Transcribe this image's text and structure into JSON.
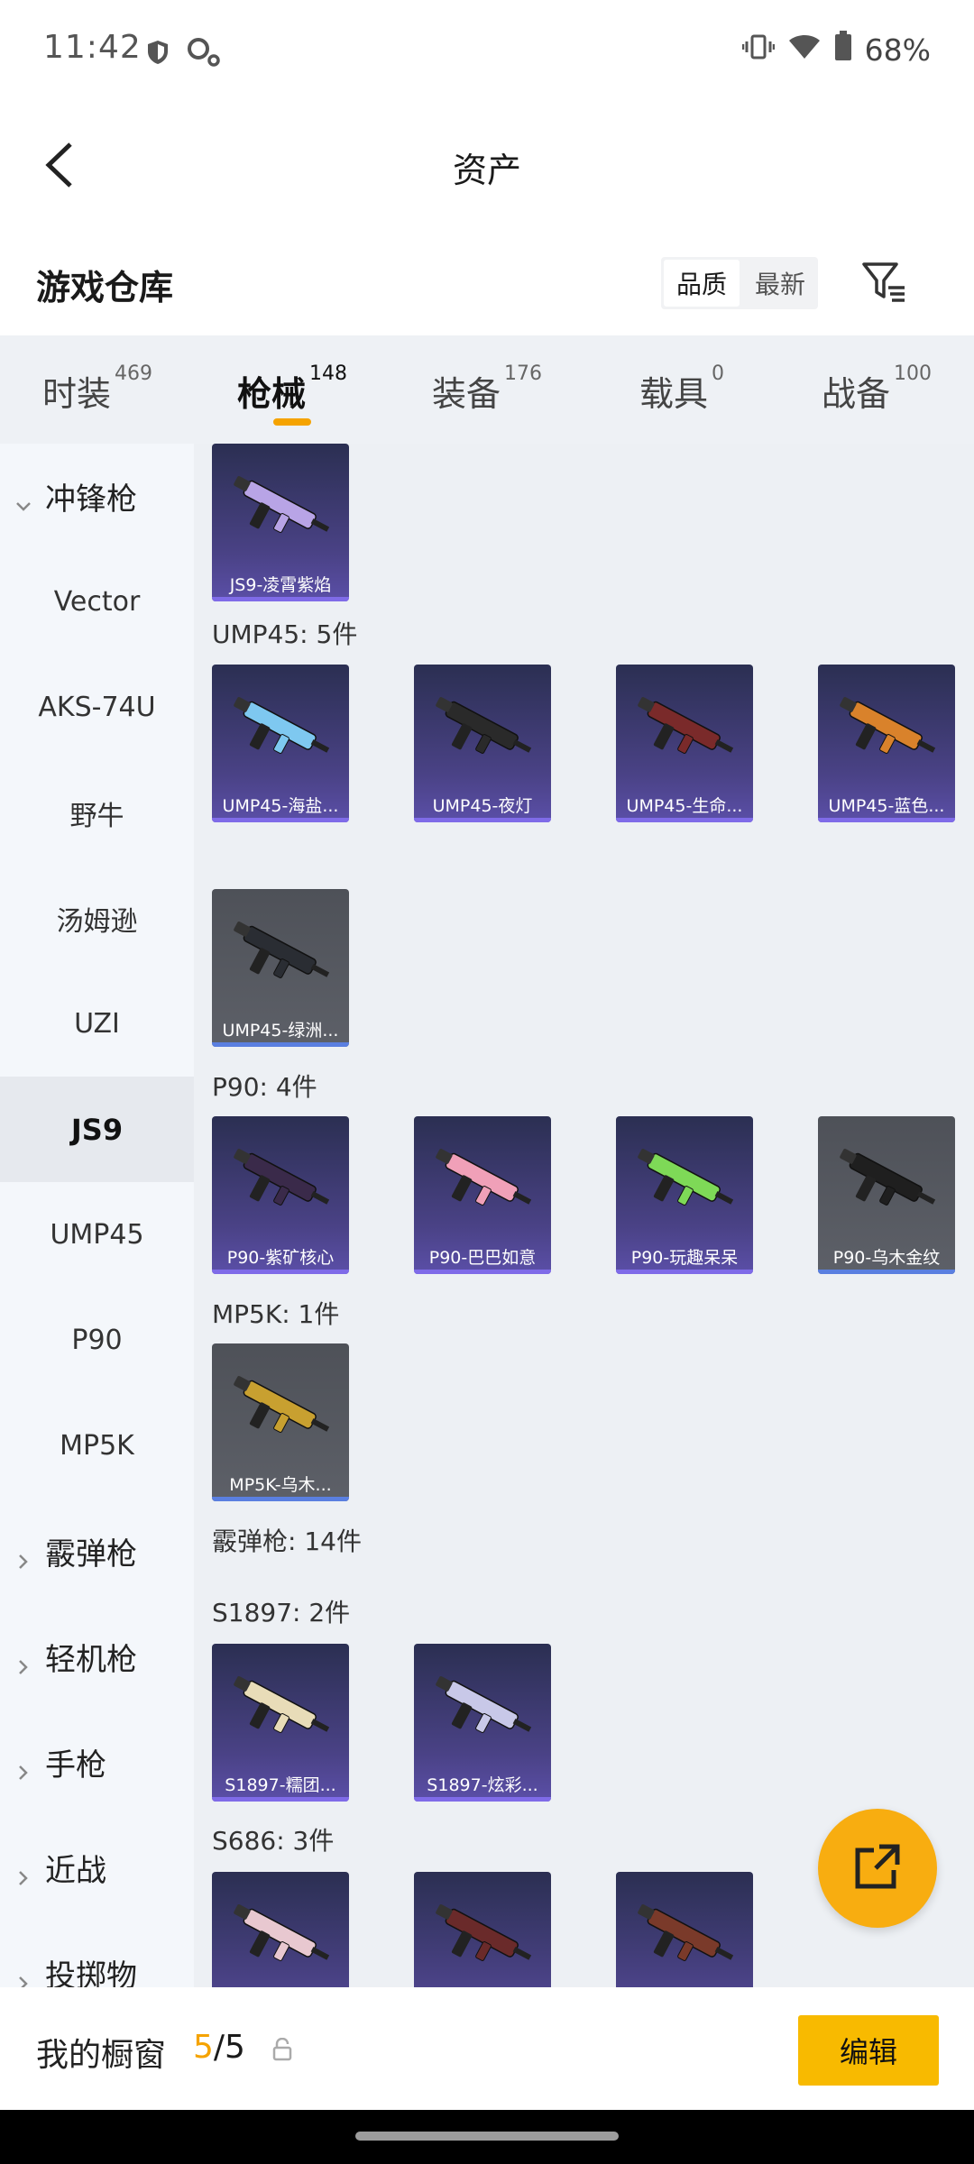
{
  "status": {
    "time": "11:42",
    "battery": "68%"
  },
  "header": {
    "title": "资产"
  },
  "warehouse": {
    "title": "游戏仓库",
    "sort_options": [
      "品质",
      "最新"
    ]
  },
  "tabs": [
    {
      "label": "时装",
      "count": "469"
    },
    {
      "label": "枪械",
      "count": "148"
    },
    {
      "label": "装备",
      "count": "176"
    },
    {
      "label": "载具",
      "count": "0"
    },
    {
      "label": "战备",
      "count": "100"
    }
  ],
  "sidebar": [
    {
      "label": "冲锋枪",
      "type": "group",
      "state": "expanded"
    },
    {
      "label": "Vector",
      "type": "item"
    },
    {
      "label": "AKS-74U",
      "type": "item"
    },
    {
      "label": "野牛",
      "type": "item"
    },
    {
      "label": "汤姆逊",
      "type": "item"
    },
    {
      "label": "UZI",
      "type": "item"
    },
    {
      "label": "JS9",
      "type": "item",
      "active": true
    },
    {
      "label": "UMP45",
      "type": "item"
    },
    {
      "label": "P90",
      "type": "item"
    },
    {
      "label": "MP5K",
      "type": "item"
    },
    {
      "label": "霰弹枪",
      "type": "group",
      "state": "collapsed"
    },
    {
      "label": "轻机枪",
      "type": "group",
      "state": "collapsed"
    },
    {
      "label": "手枪",
      "type": "group",
      "state": "collapsed"
    },
    {
      "label": "近战",
      "type": "group",
      "state": "collapsed"
    },
    {
      "label": "投掷物",
      "type": "group",
      "state": "collapsed"
    }
  ],
  "content": {
    "sections": [
      {
        "label": "UMP45: 5件"
      },
      {
        "label": "P90: 4件"
      },
      {
        "label": "MP5K: 1件"
      },
      {
        "label": "霰弹枪: 14件"
      },
      {
        "label": "S1897: 2件"
      },
      {
        "label": "S686: 3件"
      }
    ],
    "items": [
      {
        "name": "JS9-凌霄紫焰",
        "rarity": "purple",
        "color": "#b8a4e6"
      },
      {
        "name": "UMP45-海盐...",
        "rarity": "purple",
        "color": "#7ec8f0"
      },
      {
        "name": "UMP45-夜灯",
        "rarity": "purple",
        "color": "#2a2a2a"
      },
      {
        "name": "UMP45-生命...",
        "rarity": "purple",
        "color": "#7a2a2a"
      },
      {
        "name": "UMP45-蓝色...",
        "rarity": "purple",
        "color": "#d9822b"
      },
      {
        "name": "UMP45-绿洲...",
        "rarity": "gray",
        "color": "#2a2d33"
      },
      {
        "name": "P90-紫矿核心",
        "rarity": "purple",
        "color": "#3a2a4a"
      },
      {
        "name": "P90-巴巴如意",
        "rarity": "purple",
        "color": "#f0a0b8"
      },
      {
        "name": "P90-玩趣呆呆",
        "rarity": "purple",
        "color": "#7ed957"
      },
      {
        "name": "P90-乌木金纹",
        "rarity": "gray",
        "color": "#1f1f1f"
      },
      {
        "name": "MP5K-乌木...",
        "rarity": "gray",
        "color": "#c8a030"
      },
      {
        "name": "S1897-糯团...",
        "rarity": "purple",
        "color": "#e8dcb8"
      },
      {
        "name": "S1897-炫彩...",
        "rarity": "purple",
        "color": "#c8c8e8"
      },
      {
        "name": "",
        "rarity": "purple",
        "color": "#e8c8d0"
      },
      {
        "name": "",
        "rarity": "purple",
        "color": "#6a2a2a"
      },
      {
        "name": "",
        "rarity": "purple",
        "color": "#7a3a2a"
      }
    ]
  },
  "bottom": {
    "label": "我的橱窗",
    "current": "5",
    "separator": "/",
    "total": "5",
    "edit_label": "编辑"
  },
  "colors": {
    "accent": "#f5a300",
    "edit_button": "#f8ba00",
    "fab": "#f8ad10"
  }
}
